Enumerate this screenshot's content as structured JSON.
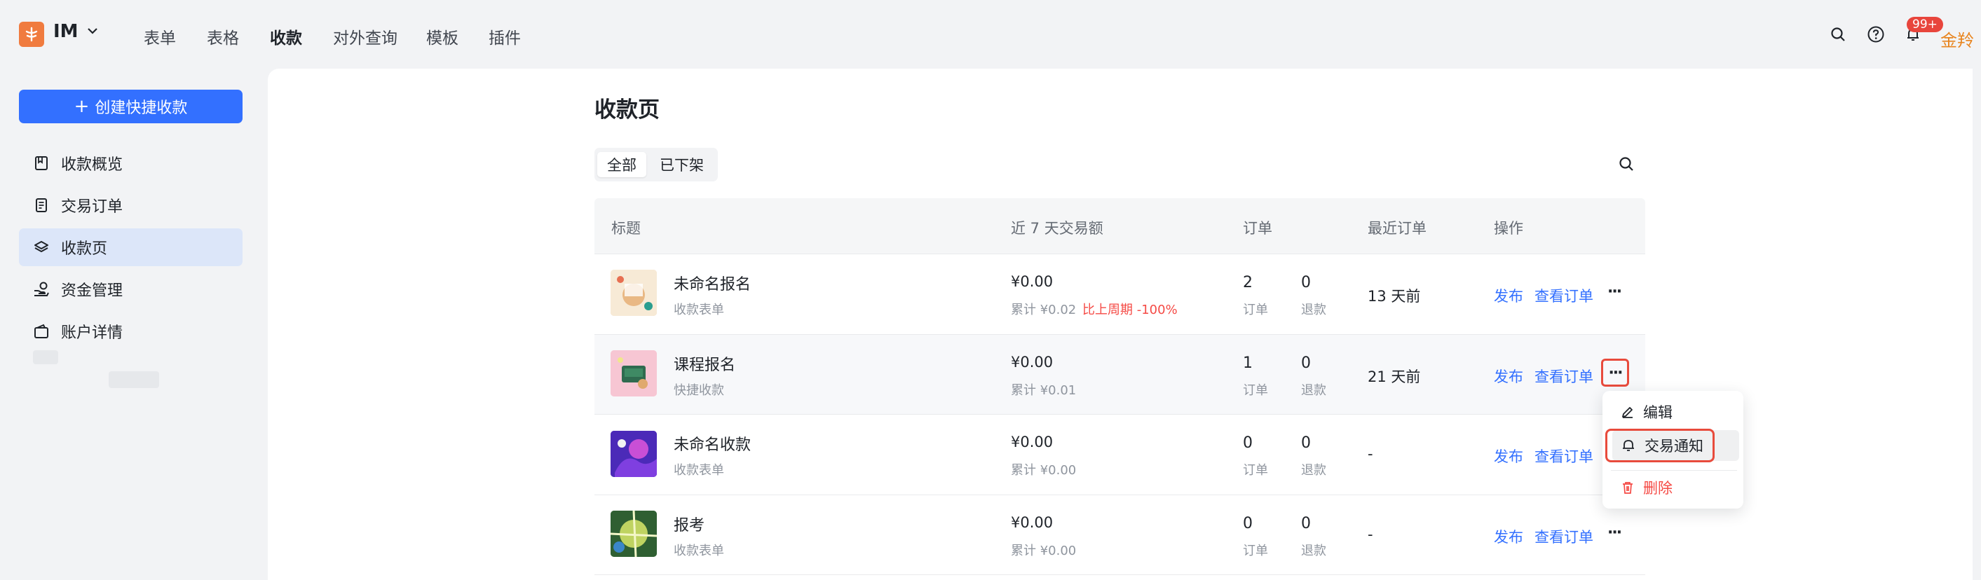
{
  "header": {
    "team_name": "IM",
    "nav": [
      "表单",
      "表格",
      "收款",
      "对外查询",
      "模板",
      "插件"
    ],
    "active_nav": "收款",
    "notification_badge": "99+",
    "brand_tail": "金羚"
  },
  "sidebar": {
    "create_button": "创建快捷收款",
    "items": [
      {
        "label": "收款概览",
        "icon": "book-icon"
      },
      {
        "label": "交易订单",
        "icon": "order-doc-icon"
      },
      {
        "label": "收款页",
        "icon": "layers-icon"
      },
      {
        "label": "资金管理",
        "icon": "hand-coin-icon"
      },
      {
        "label": "账户详情",
        "icon": "wallet-icon"
      }
    ],
    "active_item": "收款页"
  },
  "main": {
    "title": "收款页",
    "filters": [
      "全部",
      "已下架"
    ],
    "active_filter": "全部",
    "columns": [
      "标题",
      "近 7 天交易额",
      "订单",
      "最近订单",
      "操作"
    ],
    "rows": [
      {
        "title": "未命名报名",
        "type": "收款表单",
        "amount": "¥0.00",
        "cumulative": "累计 ¥0.02",
        "compare": "比上周期 -100%",
        "orders": "2",
        "orders_label": "订单",
        "refunds": "0",
        "refunds_label": "退款",
        "recent": "13 天前",
        "publish": "发布",
        "view_orders": "查看订单"
      },
      {
        "title": "课程报名",
        "type": "快捷收款",
        "amount": "¥0.00",
        "cumulative": "累计 ¥0.01",
        "compare": "",
        "orders": "1",
        "orders_label": "订单",
        "refunds": "0",
        "refunds_label": "退款",
        "recent": "21 天前",
        "publish": "发布",
        "view_orders": "查看订单"
      },
      {
        "title": "未命名收款",
        "type": "收款表单",
        "amount": "¥0.00",
        "cumulative": "累计 ¥0.00",
        "compare": "",
        "orders": "0",
        "orders_label": "订单",
        "refunds": "0",
        "refunds_label": "退款",
        "recent": "-",
        "publish": "发布",
        "view_orders": "查看订单"
      },
      {
        "title": "报考",
        "type": "收款表单",
        "amount": "¥0.00",
        "cumulative": "累计 ¥0.00",
        "compare": "",
        "orders": "0",
        "orders_label": "订单",
        "refunds": "0",
        "refunds_label": "退款",
        "recent": "-",
        "publish": "发布",
        "view_orders": "查看订单"
      }
    ],
    "more_label": "···"
  },
  "dropdown": {
    "items": [
      {
        "label": "编辑",
        "icon": "edit-icon"
      },
      {
        "label": "交易通知",
        "icon": "bell-icon"
      },
      {
        "label": "删除",
        "icon": "trash-icon"
      }
    ]
  },
  "colors": {
    "primary": "#3370ff",
    "danger": "#f54a45",
    "brand_orange": "#f07b3f",
    "highlight_outline": "#e84b3c"
  }
}
